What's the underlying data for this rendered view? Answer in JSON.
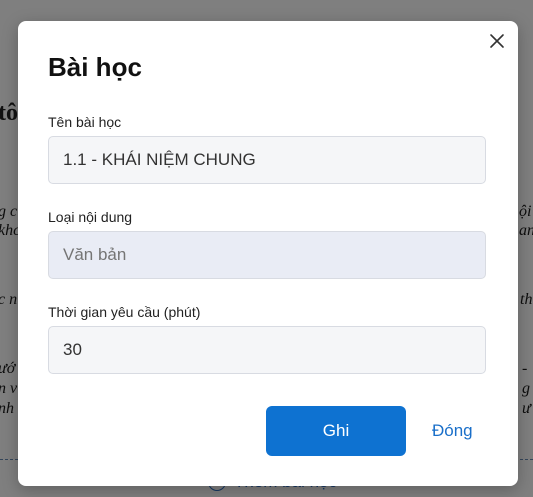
{
  "background": {
    "heading_fragment": "tô",
    "text_fragments_left": [
      "g c",
      "khc",
      "c n",
      "ướ",
      "n v",
      "nh"
    ],
    "text_fragments_right": [
      "ội",
      "an",
      "th",
      "-",
      "g",
      "ư"
    ],
    "add_lesson_label": "Thêm bài học"
  },
  "modal": {
    "title": "Bài học",
    "fields": {
      "lesson_name": {
        "label": "Tên bài học",
        "value": "1.1 - KHÁI NIỆM CHUNG"
      },
      "content_type": {
        "label": "Loại nội dung",
        "placeholder": "Văn bản"
      },
      "required_time": {
        "label": "Thời gian yêu cầu (phút)",
        "value": "30"
      }
    },
    "buttons": {
      "save": "Ghi",
      "close": "Đóng"
    }
  },
  "colors": {
    "primary": "#0e72d1",
    "link": "#1a6fc9",
    "overlay": "rgba(0,0,0,0.5)"
  }
}
